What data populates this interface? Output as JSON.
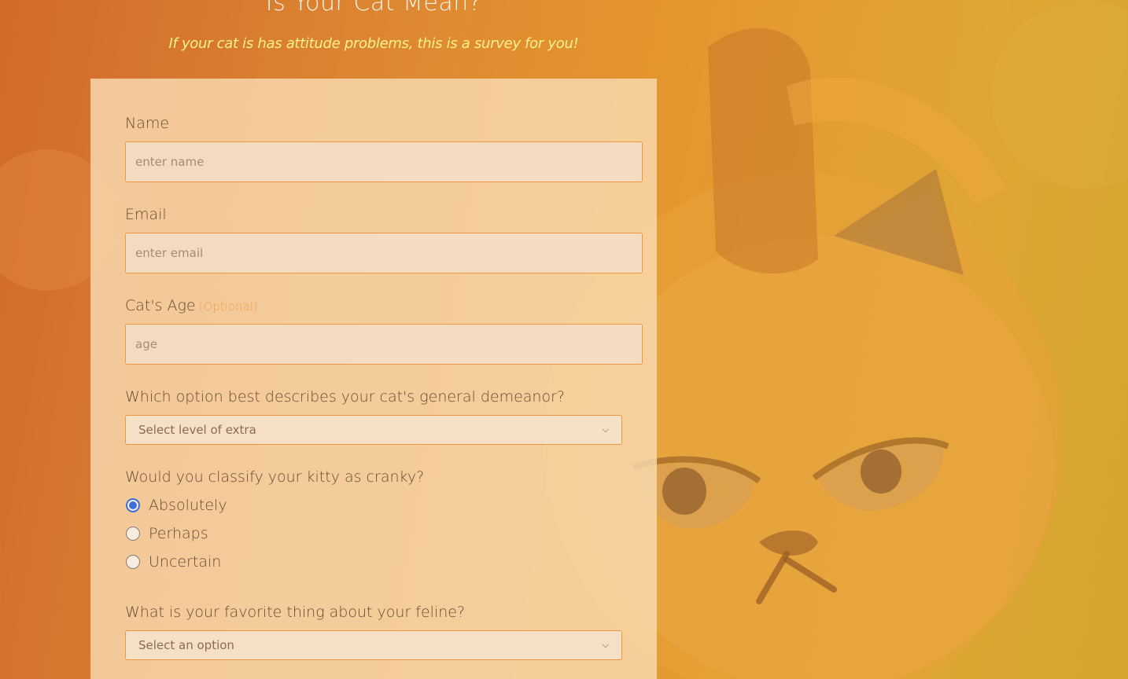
{
  "header": {
    "title": "Is Your Cat Mean?",
    "subtitle": "If your cat is has attitude problems, this is a survey for you!"
  },
  "form": {
    "name": {
      "label": "Name",
      "placeholder": "enter name",
      "value": ""
    },
    "email": {
      "label": "Email",
      "placeholder": "enter email",
      "value": ""
    },
    "age": {
      "label": "Cat's Age",
      "optional_label": "(Optional)",
      "placeholder": "age",
      "value": ""
    },
    "demeanor": {
      "label": "Which option best describes your cat's general demeanor?",
      "selected": "Select level of extra"
    },
    "cranky": {
      "label": "Would you classify your kitty as cranky?",
      "options": [
        {
          "label": "Absolutely",
          "checked": true
        },
        {
          "label": "Perhaps",
          "checked": false
        },
        {
          "label": "Uncertain",
          "checked": false
        }
      ]
    },
    "favorite": {
      "label": "What is your favorite thing about your feline?",
      "selected": "Select an option"
    }
  },
  "colors": {
    "accent": "#e99a3e",
    "radio_selected": "#3d6fd4",
    "subtitle": "#fff28a",
    "optional": "#f0a04a"
  }
}
